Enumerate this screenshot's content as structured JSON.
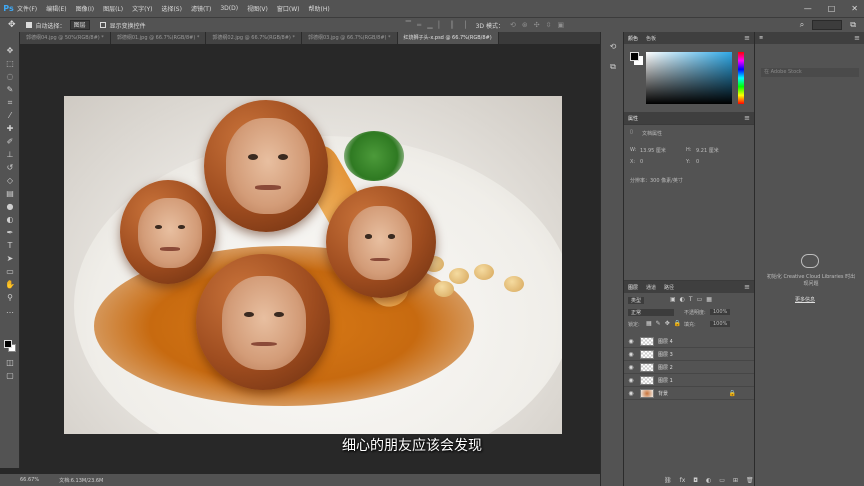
{
  "menubar": {
    "logo": "Ps",
    "items": [
      "文件(F)",
      "编辑(E)",
      "图像(I)",
      "图层(L)",
      "文字(Y)",
      "选择(S)",
      "滤镜(T)",
      "3D(D)",
      "视图(V)",
      "窗口(W)",
      "帮助(H)"
    ],
    "window_buttons": [
      "—",
      "□",
      "✕"
    ]
  },
  "options": {
    "auto_select_label": "自动选择：",
    "auto_select_value": "图层",
    "transform_label": "显示变换控件",
    "mode_label": "3D 模式："
  },
  "tabs": [
    {
      "label": "郭德纲04.jpg @ 50%(RGB/8#) *",
      "active": false
    },
    {
      "label": "郭德纲01.jpg @ 66.7%(RGB/8#) *",
      "active": false
    },
    {
      "label": "郭德纲02.jpg @ 66.7%(RGB/8#) *",
      "active": false
    },
    {
      "label": "郭德纲03.jpg @ 66.7%(RGB/8#) *",
      "active": false
    },
    {
      "label": "红烧狮子头-x.psd @ 66.7%(RGB/8#)",
      "active": true
    }
  ],
  "subtitle": "细心的朋友应该会发现",
  "status": {
    "zoom": "66.67%",
    "doc": "文档:6.13M/23.6M"
  },
  "color_panel": {
    "tabs": [
      "颜色",
      "色板"
    ],
    "accent_color": "#2ea8e6"
  },
  "properties": {
    "tabs": [
      "属性"
    ],
    "doc_props_label": "文档属性",
    "w_label": "W:",
    "w_value": "13.95 厘米",
    "h_label": "H:",
    "h_value": "9.21 厘米",
    "x_label": "X:",
    "x_value": "0",
    "y_label": "Y:",
    "y_value": "0",
    "resolution": "分辨率：300 像素/英寸"
  },
  "layers_panel": {
    "tabs": [
      "图层",
      "通道",
      "路径"
    ],
    "kind_label": "类型",
    "blend_mode": "正常",
    "opacity_label": "不透明度:",
    "opacity_value": "100%",
    "lock_label": "锁定:",
    "fill_label": "填充:",
    "fill_value": "100%",
    "layers": [
      {
        "name": "图层 4",
        "thumb": "transparent",
        "locked": false
      },
      {
        "name": "图层 3",
        "thumb": "transparent",
        "locked": false
      },
      {
        "name": "图层 2",
        "thumb": "transparent",
        "locked": false
      },
      {
        "name": "图层 1",
        "thumb": "transparent",
        "locked": false
      },
      {
        "name": "背景",
        "thumb": "food",
        "locked": true
      }
    ]
  },
  "libraries": {
    "search_placeholder": "在 Adobe Stock",
    "message": "初始化 Creative Cloud Libraries 时出现问题",
    "link": "更多信息"
  }
}
